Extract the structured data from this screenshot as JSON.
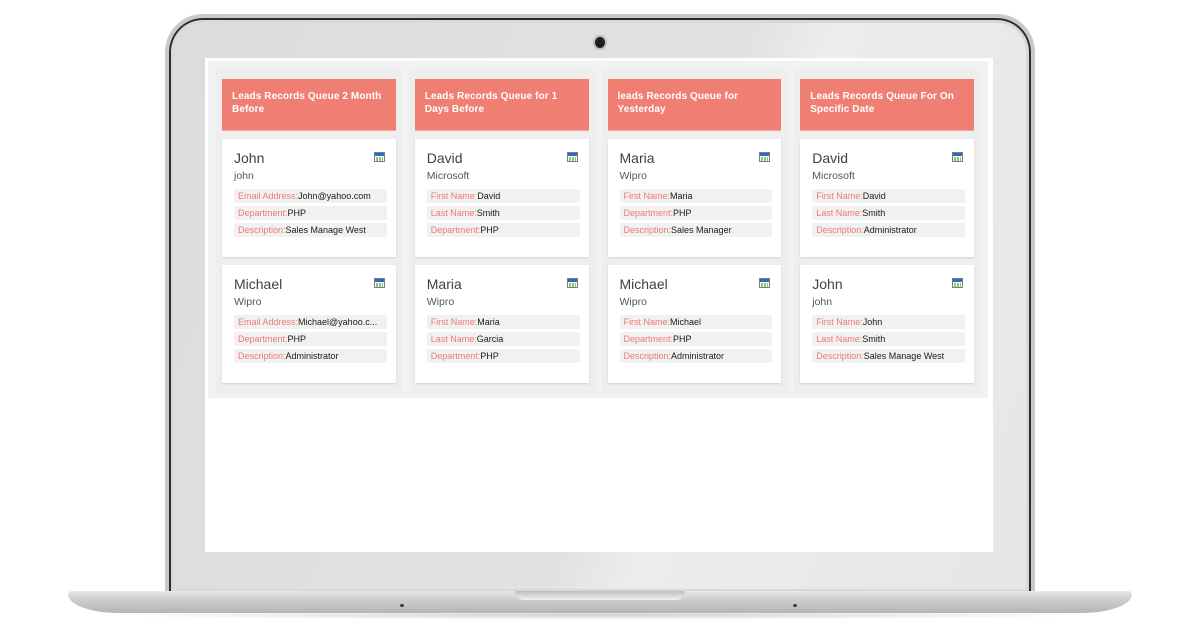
{
  "board": {
    "columns": [
      {
        "title": "Leads Records Queue 2 Month Before",
        "cards": [
          {
            "name": "John",
            "company": "john",
            "fields": [
              {
                "label": "Email Address:",
                "value": "John@yahoo.com"
              },
              {
                "label": "Department:",
                "value": "PHP"
              },
              {
                "label": "Description:",
                "value": "Sales Manage West"
              }
            ]
          },
          {
            "name": "Michael",
            "company": "Wipro",
            "fields": [
              {
                "label": "Email Address:",
                "value": "Michael@yahoo.c..."
              },
              {
                "label": "Department:",
                "value": "PHP"
              },
              {
                "label": "Description:",
                "value": "Administrator"
              }
            ]
          }
        ]
      },
      {
        "title": "Leads Records Queue for 1 Days Before",
        "cards": [
          {
            "name": "David",
            "company": "Microsoft",
            "fields": [
              {
                "label": "First Name:",
                "value": "David"
              },
              {
                "label": "Last Name:",
                "value": "Smith"
              },
              {
                "label": "Department:",
                "value": "PHP"
              }
            ]
          },
          {
            "name": "Maria",
            "company": "Wipro",
            "fields": [
              {
                "label": "First Name:",
                "value": "Maria"
              },
              {
                "label": "Last Name:",
                "value": "Garcia"
              },
              {
                "label": "Department:",
                "value": "PHP"
              }
            ]
          }
        ]
      },
      {
        "title": "leads Records Queue for Yesterday",
        "cards": [
          {
            "name": "Maria",
            "company": "Wipro",
            "fields": [
              {
                "label": "First Name:",
                "value": "Maria"
              },
              {
                "label": "Department:",
                "value": "PHP"
              },
              {
                "label": "Description:",
                "value": "Sales Manager"
              }
            ]
          },
          {
            "name": "Michael",
            "company": "Wipro",
            "fields": [
              {
                "label": "First Name:",
                "value": "Michael"
              },
              {
                "label": "Department:",
                "value": "PHP"
              },
              {
                "label": "Description:",
                "value": "Administrator"
              }
            ]
          }
        ]
      },
      {
        "title": "Leads Records Queue For On Specific Date",
        "cards": [
          {
            "name": "David",
            "company": "Microsoft",
            "fields": [
              {
                "label": "First Name:",
                "value": "David"
              },
              {
                "label": "Last Name:",
                "value": "Smith"
              },
              {
                "label": "Description:",
                "value": "Administrator"
              }
            ]
          },
          {
            "name": "John",
            "company": "john",
            "fields": [
              {
                "label": "First Name:",
                "value": "John"
              },
              {
                "label": "Last Name:",
                "value": "Smith"
              },
              {
                "label": "Description:",
                "value": "Sales Manage West"
              }
            ]
          }
        ]
      }
    ]
  },
  "icons": {
    "card_action": "calendar-icon"
  },
  "colors": {
    "header_bg": "#f07f73",
    "label": "#ec7b72",
    "field_bg": "#f1f1f1",
    "board_bg": "#f2f2f2"
  }
}
